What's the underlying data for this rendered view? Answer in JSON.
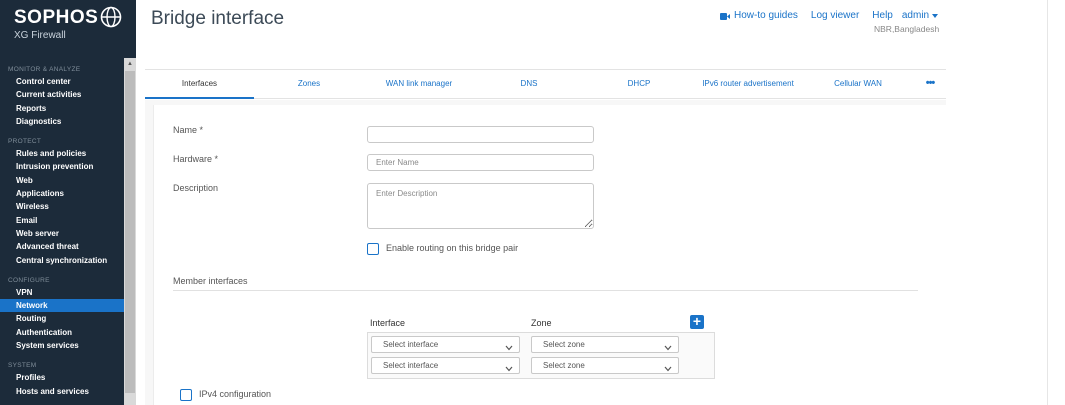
{
  "brand": {
    "name": "SOPHOS",
    "product": "XG Firewall"
  },
  "sidebar": {
    "sections": [
      {
        "title": "MONITOR & ANALYZE",
        "items": [
          "Control center",
          "Current activities",
          "Reports",
          "Diagnostics"
        ]
      },
      {
        "title": "PROTECT",
        "items": [
          "Rules and policies",
          "Intrusion prevention",
          "Web",
          "Applications",
          "Wireless",
          "Email",
          "Web server",
          "Advanced threat",
          "Central synchronization"
        ]
      },
      {
        "title": "CONFIGURE",
        "items": [
          "VPN",
          "Network",
          "Routing",
          "Authentication",
          "System services"
        ]
      },
      {
        "title": "SYSTEM",
        "items": [
          "Profiles",
          "Hosts and services"
        ]
      }
    ],
    "active_item": "Network"
  },
  "header": {
    "title": "Bridge interface",
    "howto": "How-to guides",
    "log_viewer": "Log viewer",
    "help": "Help",
    "admin": "admin",
    "location": "NBR,Bangladesh"
  },
  "tabs": [
    "Interfaces",
    "Zones",
    "WAN link manager",
    "DNS",
    "DHCP",
    "IPv6 router advertisement",
    "Cellular WAN"
  ],
  "active_tab": "Interfaces",
  "form": {
    "name_label": "Name *",
    "name_value": "",
    "hardware_label": "Hardware *",
    "hardware_placeholder": "Enter Name",
    "description_label": "Description",
    "description_placeholder": "Enter Description",
    "routing_checkbox": "Enable routing on this bridge pair",
    "member_section": "Member interfaces",
    "interface_col": "Interface",
    "zone_col": "Zone",
    "rows": [
      {
        "interface": "Select interface",
        "zone": "Select zone"
      },
      {
        "interface": "Select interface",
        "zone": "Select zone"
      }
    ],
    "ipv4_checkbox": "IPv4 configuration"
  },
  "colors": {
    "sidebar_bg": "#1c2b3a",
    "accent": "#1a73c8"
  }
}
